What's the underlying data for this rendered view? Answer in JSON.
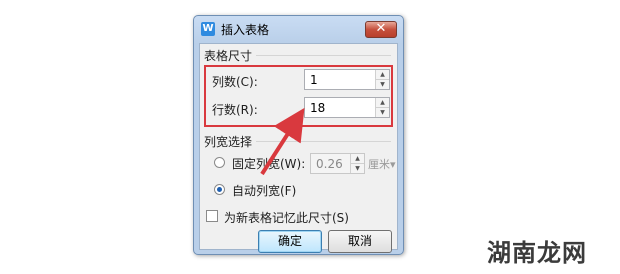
{
  "dialog": {
    "title": "插入表格",
    "app_icon": "W",
    "close_glyph": "✕",
    "size_group": {
      "title": "表格尺寸",
      "columns_label": "列数(C):",
      "columns_value": "1",
      "rows_label": "行数(R):",
      "rows_value": "18"
    },
    "width_group": {
      "title": "列宽选择",
      "fixed_label": "固定列宽(W):",
      "fixed_value": "0.26",
      "unit": "厘米",
      "auto_label": "自动列宽(F)",
      "selected": "auto"
    },
    "remember_label": "为新表格记忆此尺寸(S)",
    "ok_label": "确定",
    "cancel_label": "取消"
  },
  "watermark": "湖南龙网",
  "colors": {
    "highlight": "#d9393e",
    "arrow": "#d9393e"
  }
}
